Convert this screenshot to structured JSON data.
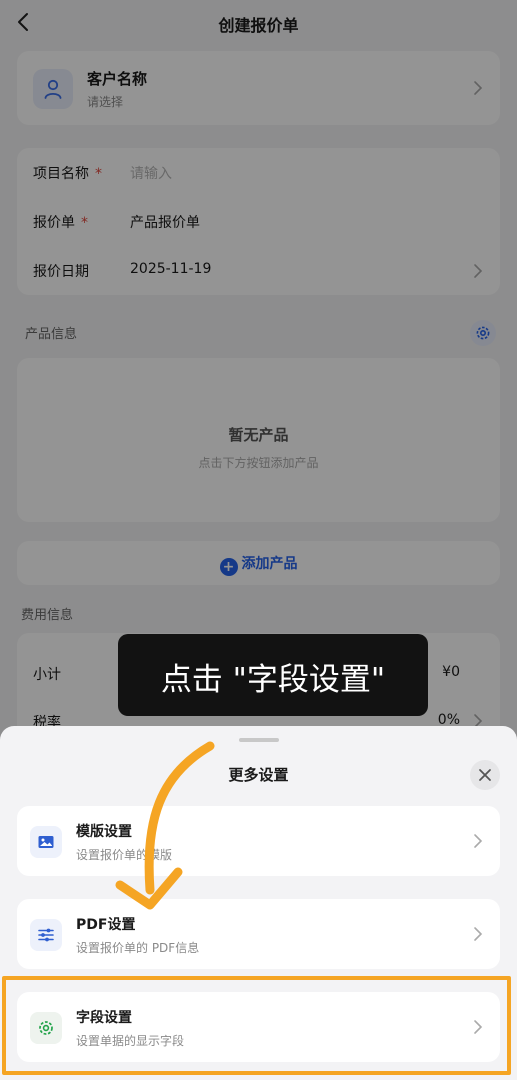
{
  "nav": {
    "title": "创建报价单",
    "back_icon": "chevron-left-icon"
  },
  "customer": {
    "name": "客户名称",
    "hint": "请选择",
    "icon": "user-icon"
  },
  "form": {
    "project": {
      "label": "项目名称",
      "required_mark": "*",
      "placeholder": "请输入"
    },
    "quote": {
      "label": "报价单",
      "required_mark": "*",
      "value": "产品报价单"
    },
    "date": {
      "label": "报价日期",
      "value": "2025-11-19"
    }
  },
  "products": {
    "section_title": "产品信息",
    "empty_title": "暂无产品",
    "empty_hint": "点击下方按钮添加产品",
    "add_label": "添加产品",
    "add_symbol": "+"
  },
  "fees": {
    "section_title": "费用信息",
    "subtotal_label": "小计",
    "subtotal_value": "¥0",
    "tax_label": "税率",
    "tax_value": "0%"
  },
  "sheet": {
    "title": "更多设置",
    "options": [
      {
        "title": "模版设置",
        "subtitle": "设置报价单的模版",
        "icon": "image-icon"
      },
      {
        "title": "PDF设置",
        "subtitle": "设置报价单的 PDF信息",
        "icon": "sliders-icon"
      },
      {
        "title": "字段设置",
        "subtitle": "设置单据的显示字段",
        "icon": "gear-icon"
      }
    ]
  },
  "tooltip": {
    "text": "点击 \"字段设置\""
  },
  "colors": {
    "accent": "#2563eb",
    "highlight": "#f5a524",
    "required": "#e0463c",
    "field_icon": "#22a34a"
  }
}
